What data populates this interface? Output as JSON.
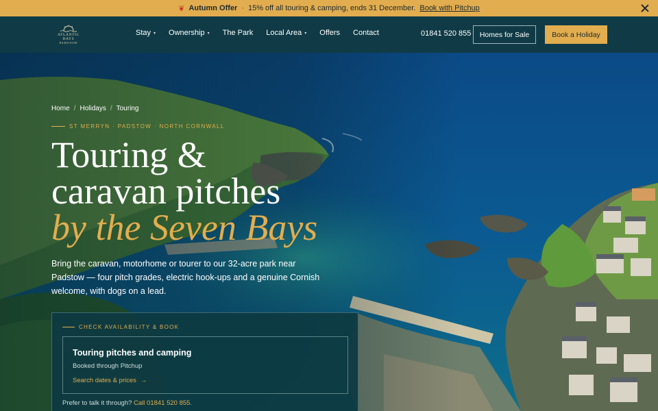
{
  "announcement": {
    "icon": "leaf-icon",
    "title": "Autumn Offer",
    "separator": "·",
    "text": "15% off all touring & camping, ends 31 December.",
    "link": "Book with Pitchup"
  },
  "brand": {
    "name": "ATLANTIC BAYS",
    "place": "PADSTOW"
  },
  "nav": {
    "items": [
      {
        "label": "Stay",
        "caret": "▾"
      },
      {
        "label": "Ownership",
        "caret": "▾"
      },
      {
        "label": "The Park",
        "caret": ""
      },
      {
        "label": "Local Area",
        "caret": "▾"
      },
      {
        "label": "Offers",
        "caret": ""
      },
      {
        "label": "Contact",
        "caret": ""
      }
    ],
    "phone": "01841 520 855",
    "secondary_cta": "Homes for Sale",
    "primary_cta": "Book a Holiday"
  },
  "breadcrumb": {
    "items": [
      "Home",
      "Holidays",
      "Touring"
    ],
    "separator": "/"
  },
  "hero": {
    "eyebrow": "ST MERRYN · PADSTOW · NORTH CORNWALL",
    "title_line1": "Touring &",
    "title_line2": "caravan pitches",
    "title_accent": "by the Seven Bays",
    "lede": "Bring the caravan, motorhome or tourer to our 32-acre park near Padstow — four pitch grades, electric hook-ups and a genuine Cornish welcome, with dogs on a lead."
  },
  "booking_card": {
    "kicker": "CHECK AVAILABILITY & BOOK",
    "option_title": "Touring pitches and camping",
    "option_subtitle": "Booked through Pitchup",
    "option_link": "Search dates & prices",
    "option_link_icon": "arrow-right-icon",
    "footer_text": "Prefer to talk it through?",
    "footer_link": "Call 01841 520 855."
  },
  "colors": {
    "accent": "#e2ad4f",
    "nav_bg": "#103b46",
    "card_bg": "#0e3a42"
  }
}
